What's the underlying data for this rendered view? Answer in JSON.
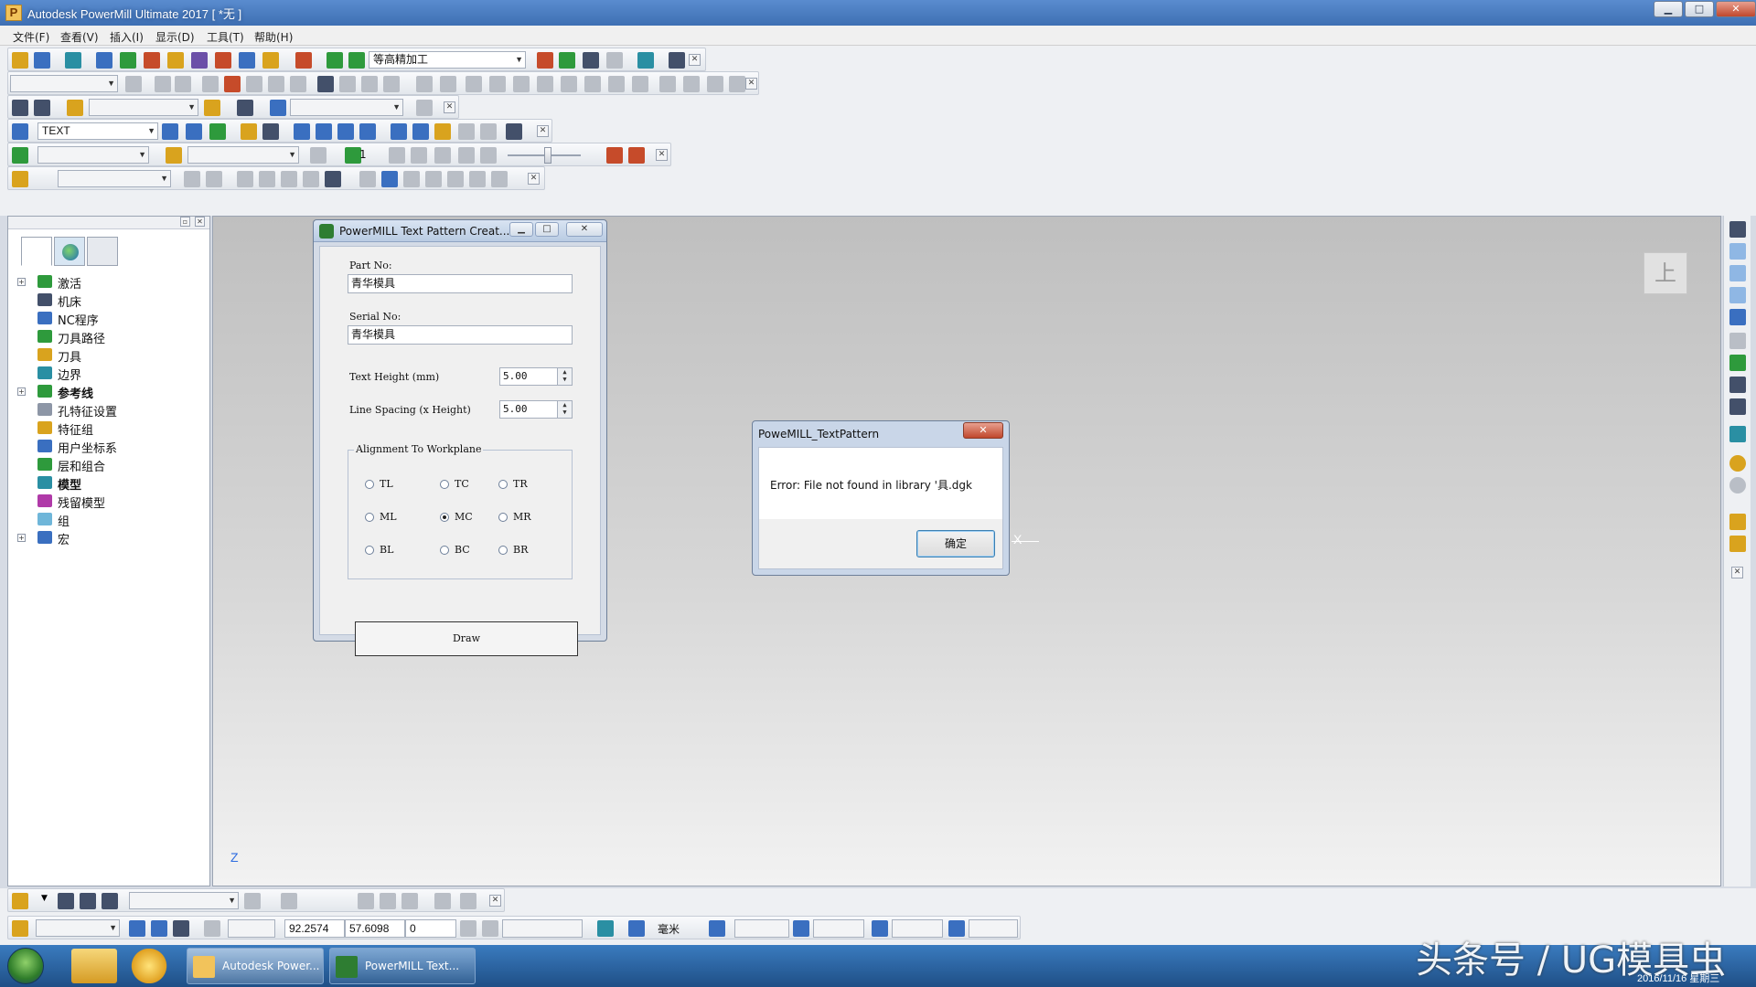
{
  "window": {
    "title": "Autodesk PowerMill Ultimate 2017   [ *无 ]",
    "app_icon_letter": "P",
    "minimize": "▁",
    "maximize": "□",
    "close": "✕"
  },
  "menu": [
    "文件(F)",
    "查看(V)",
    "插入(I)",
    "显示(D)",
    "工具(T)",
    "帮助(H)"
  ],
  "toolbars": {
    "strategy_combo": "等高精加工",
    "text_combo": "TEXT",
    "slider_number": "1"
  },
  "explorer": {
    "items": [
      {
        "label": "激活",
        "bold": false,
        "expandable": true,
        "icon": "activate-icon",
        "color": "#2e9a3c"
      },
      {
        "label": "机床",
        "bold": false,
        "expandable": false,
        "icon": "machine-icon",
        "color": "#43506a"
      },
      {
        "label": "NC程序",
        "bold": false,
        "expandable": false,
        "icon": "nc-program-icon",
        "color": "#3a6fc0"
      },
      {
        "label": "刀具路径",
        "bold": false,
        "expandable": false,
        "icon": "toolpath-icon",
        "color": "#2e9a3c"
      },
      {
        "label": "刀具",
        "bold": false,
        "expandable": false,
        "icon": "tool-icon",
        "color": "#d9a31e"
      },
      {
        "label": "边界",
        "bold": false,
        "expandable": false,
        "icon": "boundary-icon",
        "color": "#2a8fa3"
      },
      {
        "label": "参考线",
        "bold": true,
        "expandable": true,
        "icon": "pattern-icon",
        "color": "#2e9a3c"
      },
      {
        "label": "孔特征设置",
        "bold": false,
        "expandable": false,
        "icon": "hole-feature-icon",
        "color": "#8d96a6"
      },
      {
        "label": "特征组",
        "bold": false,
        "expandable": false,
        "icon": "feature-group-icon",
        "color": "#d9a31e"
      },
      {
        "label": "用户坐标系",
        "bold": false,
        "expandable": false,
        "icon": "workplane-icon",
        "color": "#3a6fc0"
      },
      {
        "label": "层和组合",
        "bold": false,
        "expandable": false,
        "icon": "layers-icon",
        "color": "#2e9a3c"
      },
      {
        "label": "模型",
        "bold": true,
        "expandable": false,
        "icon": "model-icon",
        "color": "#2a8fa3"
      },
      {
        "label": "残留模型",
        "bold": false,
        "expandable": false,
        "icon": "stock-model-icon",
        "color": "#b03aa8"
      },
      {
        "label": "组",
        "bold": false,
        "expandable": false,
        "icon": "group-icon",
        "color": "#6fb6d9"
      },
      {
        "label": "宏",
        "bold": false,
        "expandable": true,
        "icon": "macro-icon",
        "color": "#3a6fc0"
      }
    ]
  },
  "viewport": {
    "viewcube_label": "上",
    "axis_x": "X",
    "axis_z": "Z"
  },
  "text_dialog": {
    "title": "PowerMILL Text Pattern Creat...",
    "part_no_label": "Part No:",
    "part_no_value": "青华模具",
    "serial_no_label": "Serial No:",
    "serial_no_value": "青华模具",
    "text_height_label": "Text Height (mm)",
    "text_height_value": "5.00",
    "line_spacing_label": "Line Spacing (x Height)",
    "line_spacing_value": "5.00",
    "alignment_title": "Alignment To Workplane",
    "alignment_options": [
      "TL",
      "TC",
      "TR",
      "ML",
      "MC",
      "MR",
      "BL",
      "BC",
      "BR"
    ],
    "alignment_selected": "MC",
    "draw_label": "Draw"
  },
  "error_dialog": {
    "title": "PoweMILL_TextPattern",
    "message": "Error: File not found in library '具.dgk",
    "ok_label": "确定",
    "close": "✕"
  },
  "status": {
    "x_value": "92.2574",
    "y_value": "57.6098",
    "z_value": "0",
    "units": "毫米"
  },
  "taskbar": {
    "buttons": [
      {
        "label": "Autodesk Power..."
      },
      {
        "label": "PowerMILL Text..."
      }
    ],
    "watermark": "头条号 / UG模具虫",
    "date": "2016/11/16 星期三"
  }
}
